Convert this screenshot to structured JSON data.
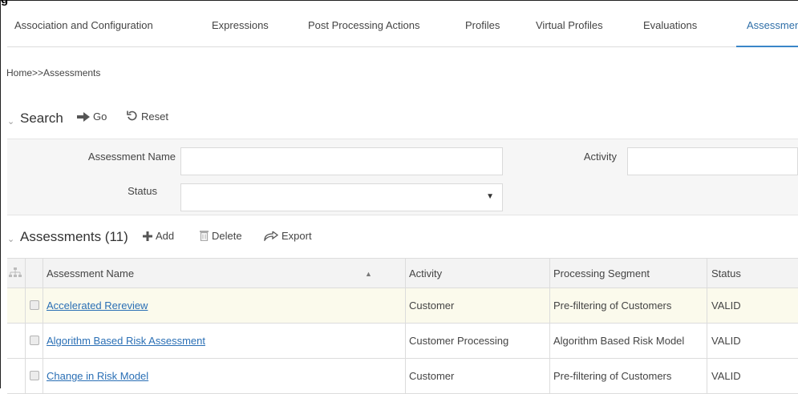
{
  "figure_label": "g",
  "tabs": [
    {
      "label": "Association and Configuration",
      "active": false
    },
    {
      "label": "Expressions",
      "active": false
    },
    {
      "label": "Post Processing Actions",
      "active": false
    },
    {
      "label": "Profiles",
      "active": false
    },
    {
      "label": "Virtual Profiles",
      "active": false
    },
    {
      "label": "Evaluations",
      "active": false
    },
    {
      "label": "Assessment",
      "active": true
    }
  ],
  "breadcrumb": "Home>>Assessments",
  "search": {
    "title": "Search",
    "go_label": "Go",
    "reset_label": "Reset",
    "fields": {
      "assessment_name_label": "Assessment Name",
      "assessment_name_value": "",
      "activity_label": "Activity",
      "activity_value": "",
      "status_label": "Status",
      "status_value": ""
    }
  },
  "assessments": {
    "title": "Assessments (11)",
    "add_label": "Add",
    "delete_label": "Delete",
    "export_label": "Export",
    "columns": [
      "Assessment Name",
      "Activity",
      "Processing Segment",
      "Status"
    ],
    "sort_indicator": "▲",
    "rows": [
      {
        "name": "Accelerated Rereview",
        "activity": "Customer",
        "segment": "Pre-filtering of Customers",
        "status": "VALID"
      },
      {
        "name": "Algorithm Based Risk Assessment",
        "activity": "Customer Processing",
        "segment": "Algorithm Based Risk Model",
        "status": "VALID"
      },
      {
        "name": "Change in Risk Model",
        "activity": "Customer",
        "segment": "Pre-filtering of Customers",
        "status": "VALID"
      }
    ]
  },
  "colors": {
    "accent": "#3a86c8",
    "link": "#2a6fb5",
    "selected_row": "#fbfaec",
    "header_bg": "#f3f3f3",
    "panel_bg": "#f6f6f6"
  }
}
